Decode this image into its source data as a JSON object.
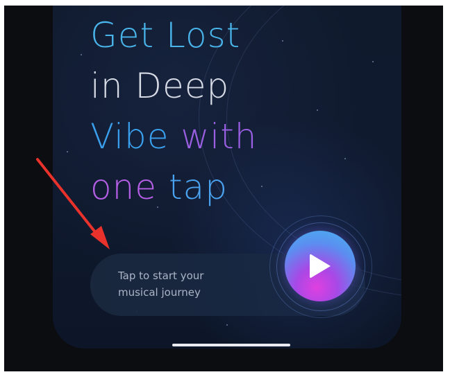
{
  "headline": {
    "line1": "Get Lost",
    "line2": "in Deep",
    "line3_part1": "Vibe",
    "line3_part2": "with",
    "line4_part1": "one",
    "line4_part2": "tap"
  },
  "cta": {
    "line1": "Tap to start your",
    "line2": "musical journey"
  },
  "icons": {
    "play": "play-icon",
    "annotation": "red-arrow-icon"
  },
  "colors": {
    "background": "#0c0d11",
    "phone_surface": "#101a2f",
    "headline_blue": "#49b4ea",
    "headline_purple": "#9a5fe2",
    "arrow_red": "#e8322b",
    "play_gradient_top": "#45b7ef",
    "play_gradient_bottom": "#e040e0"
  }
}
